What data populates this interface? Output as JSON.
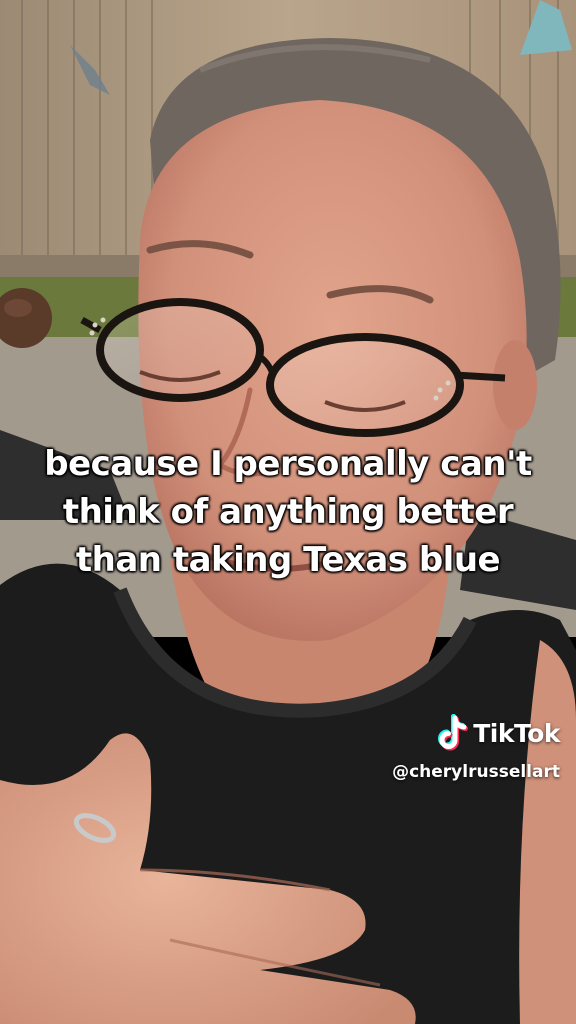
{
  "video": {
    "caption_lines": [
      "because I personally can't",
      "think of anything better",
      "than taking Texas blue"
    ]
  },
  "watermark": {
    "brand": "TikTok",
    "handle": "@cherylrussellart",
    "icon": "tiktok-logo-icon"
  },
  "colors": {
    "caption_text": "#ffffff",
    "logo_cyan": "#25F4EE",
    "logo_red": "#FE2C55"
  }
}
